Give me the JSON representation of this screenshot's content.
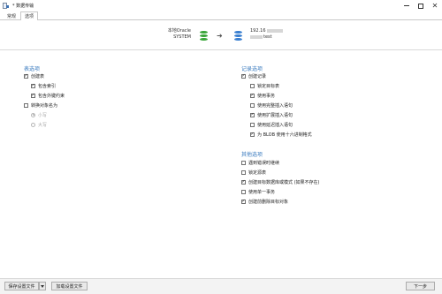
{
  "window": {
    "title": "* 数据传输"
  },
  "tabs": [
    {
      "label": "常规"
    },
    {
      "label": "选项"
    }
  ],
  "transfer": {
    "source_line1": "本地Oracle",
    "source_line2": "SYSTEM",
    "target_line1": "192.16",
    "target_line2": "test"
  },
  "table_options": {
    "title": "表选项",
    "items": [
      {
        "label": "创建表",
        "checked": true
      },
      {
        "label": "包含索引",
        "checked": true
      },
      {
        "label": "包含外键约束",
        "checked": true
      },
      {
        "label": "转换对象名为",
        "checked": false
      }
    ],
    "radios": [
      {
        "label": "小写"
      },
      {
        "label": "大写"
      }
    ]
  },
  "record_options": {
    "title": "记录选项",
    "items": [
      {
        "label": "创建记录",
        "checked": true
      },
      {
        "label": "锁定目标表",
        "checked": false
      },
      {
        "label": "使用事务",
        "checked": true
      },
      {
        "label": "使用完整插入语句",
        "checked": false
      },
      {
        "label": "使用扩展插入语句",
        "checked": true
      },
      {
        "label": "使用延迟插入语句",
        "checked": false
      },
      {
        "label": "为 BLOB 使用十六进制格式",
        "checked": true
      }
    ]
  },
  "other_options": {
    "title": "其他选项",
    "items": [
      {
        "label": "遇到错误时继续",
        "checked": false
      },
      {
        "label": "锁定源表",
        "checked": false
      },
      {
        "label": "创建目标数据库或模式 (如果不存在)",
        "checked": true
      },
      {
        "label": "使用单一事务",
        "checked": false
      },
      {
        "label": "创建前删除目标对象",
        "checked": true
      }
    ]
  },
  "footer": {
    "save_label": "保存设置文件",
    "load_label": "加载设置文件",
    "next_label": "下一步"
  },
  "icons": {
    "source_db": "database-green-icon",
    "target_db": "database-blue-icon",
    "arrow": "arrow-right-icon"
  },
  "colors": {
    "section_title": "#3a7bbf",
    "source_db": "#3aa63a",
    "target_db": "#3a7fd0"
  }
}
